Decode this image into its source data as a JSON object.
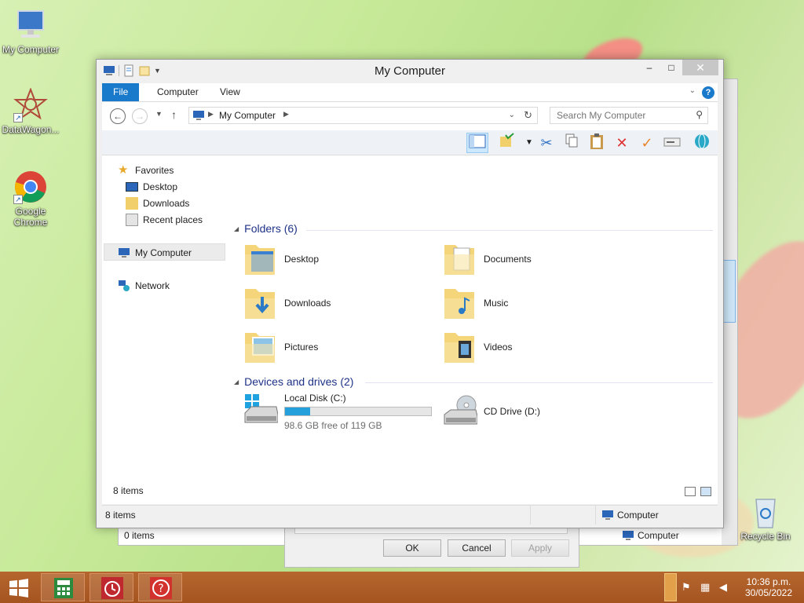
{
  "desktop": {
    "icons": [
      {
        "label": "My Computer"
      },
      {
        "label": "DataWagon..."
      },
      {
        "label": "Google Chrome"
      },
      {
        "label": "Recycle Bin"
      }
    ]
  },
  "window": {
    "title": "My Computer",
    "controls": {
      "minimize": "–",
      "maximize": "□",
      "close": "✕"
    }
  },
  "ribbon": {
    "tabs": [
      "File",
      "Computer",
      "View"
    ],
    "help": "?"
  },
  "navigation": {
    "address_crumb": "My Computer",
    "search_placeholder": "Search My Computer"
  },
  "nav_pane": {
    "favorites_label": "Favorites",
    "favorites": [
      "Desktop",
      "Downloads",
      "Recent places"
    ],
    "computer": "My Computer",
    "network": "Network"
  },
  "folders_group": {
    "header": "Folders (6)",
    "items": [
      "Desktop",
      "Documents",
      "Downloads",
      "Music",
      "Pictures",
      "Videos"
    ]
  },
  "drives_group": {
    "header": "Devices and drives (2)",
    "local_disk": {
      "name": "Local Disk (C:)",
      "space": "98.6 GB free of 119 GB",
      "used_fraction": 0.171
    },
    "cd_drive": {
      "name": "CD Drive (D:)"
    }
  },
  "content_footer": {
    "items_count": "8 items"
  },
  "status_bar": {
    "items": "8 items",
    "location": "Computer"
  },
  "background_window": {
    "items": "0 items",
    "location": "Computer"
  },
  "dialog": {
    "ok": "OK",
    "cancel": "Cancel",
    "apply": "Apply"
  },
  "taskbar": {
    "time": "10:36 p.m.",
    "date": "30/05/2022"
  },
  "colors": {
    "accent": "#1979ca",
    "taskbar": "#a55420",
    "drive_fill": "#26a0da"
  }
}
